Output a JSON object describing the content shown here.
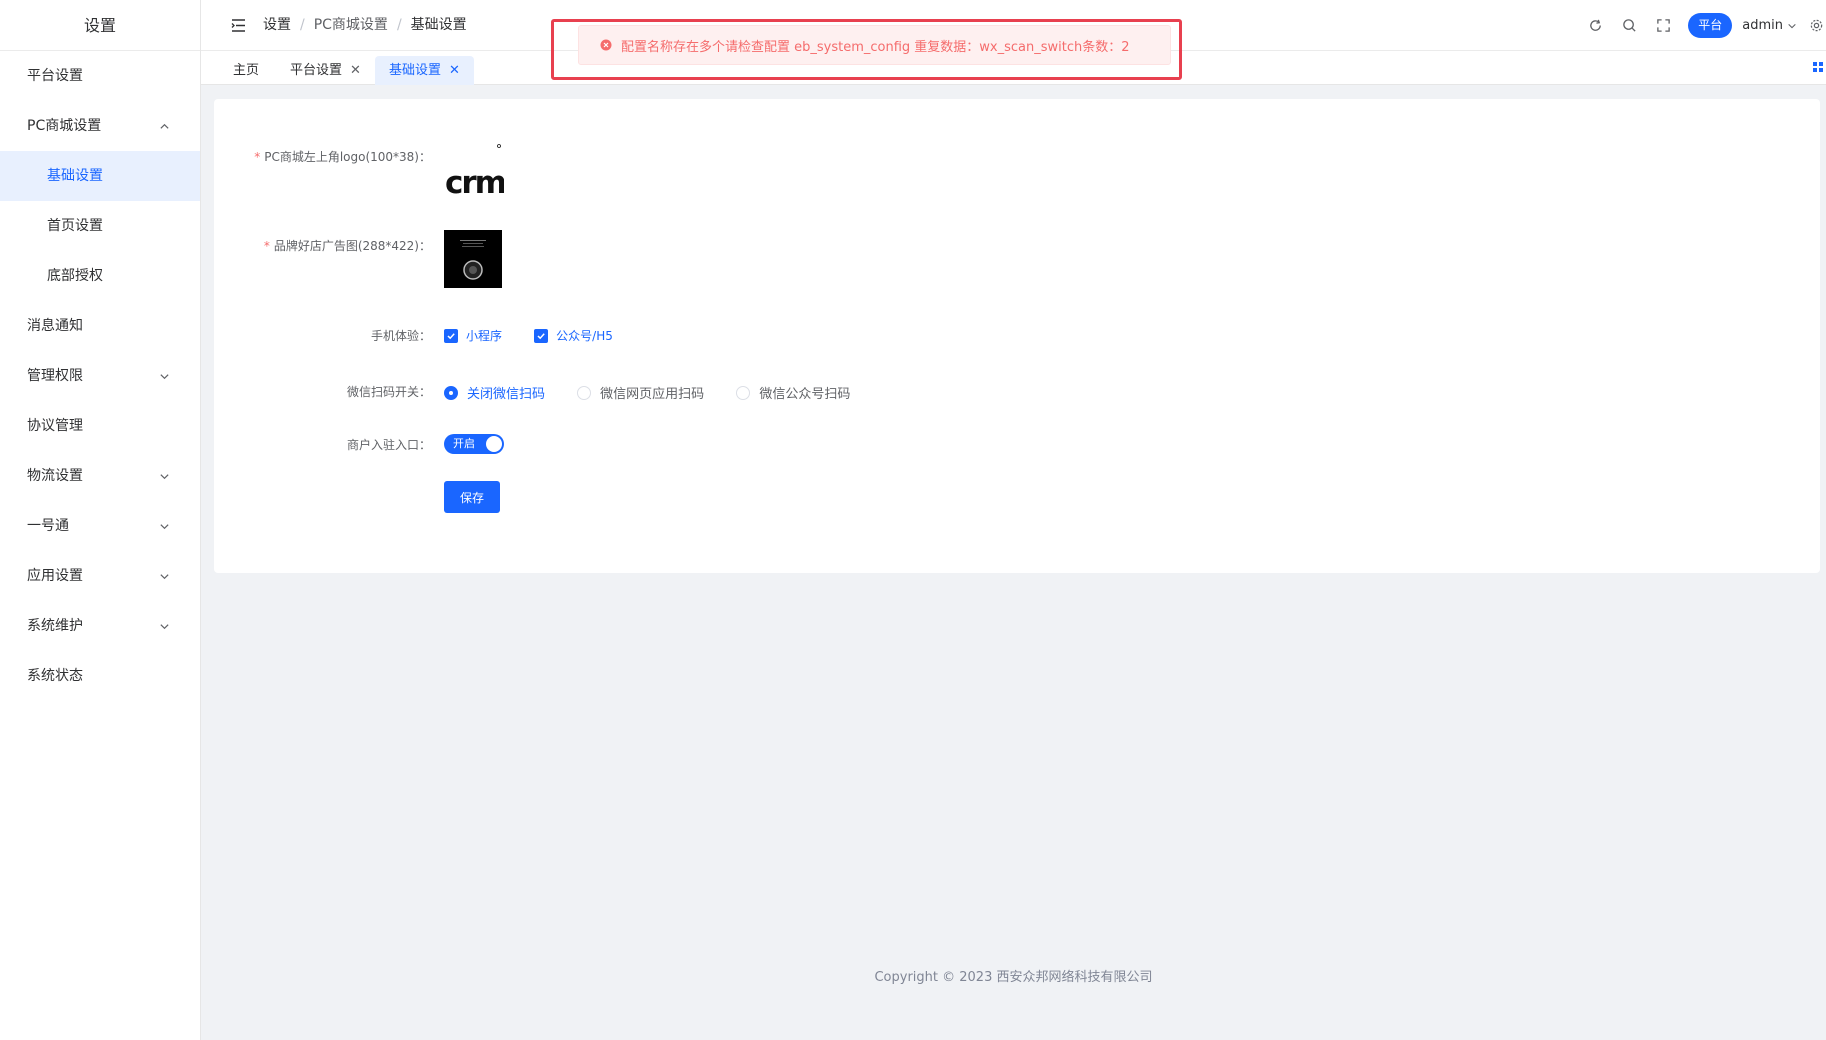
{
  "sidebar": {
    "title": "设置",
    "items": [
      {
        "label": "平台设置"
      },
      {
        "label": "PC商城设置"
      },
      {
        "label": "基础设置"
      },
      {
        "label": "首页设置"
      },
      {
        "label": "底部授权"
      },
      {
        "label": "消息通知"
      },
      {
        "label": "管理权限"
      },
      {
        "label": "协议管理"
      },
      {
        "label": "物流设置"
      },
      {
        "label": "一号通"
      },
      {
        "label": "应用设置"
      },
      {
        "label": "系统维护"
      },
      {
        "label": "系统状态"
      }
    ]
  },
  "header": {
    "breadcrumb": [
      "设置",
      "PC商城设置",
      "基础设置"
    ],
    "separator": "/",
    "platform_badge": "平台",
    "user": "admin"
  },
  "tabs": [
    {
      "label": "主页"
    },
    {
      "label": "平台设置",
      "close": "✕"
    },
    {
      "label": "基础设置",
      "close": "✕"
    }
  ],
  "form": {
    "logo_label": "PC商城左上角logo(100*38)：",
    "logo_text": "crmeb",
    "ad_label": "品牌好店广告图(288*422)：",
    "mobile_label": "手机体验：",
    "mobile_options": [
      "小程序",
      "公众号/H5"
    ],
    "wechat_label": "微信扫码开关：",
    "wechat_options": [
      "关闭微信扫码",
      "微信网页应用扫码",
      "微信公众号扫码"
    ],
    "merchant_label": "商户入驻入口：",
    "merchant_switch": "开启",
    "save": "保存",
    "required_mark": "*"
  },
  "footer": "Copyright © 2023 西安众邦网络科技有限公司",
  "alert": {
    "message": "配置名称存在多个请检查配置 eb_system_config 重复数据：wx_scan_switch条数：2"
  },
  "colors": {
    "primary": "#1a66ff",
    "error": "#f56c6c",
    "frame": "#e8404f"
  }
}
